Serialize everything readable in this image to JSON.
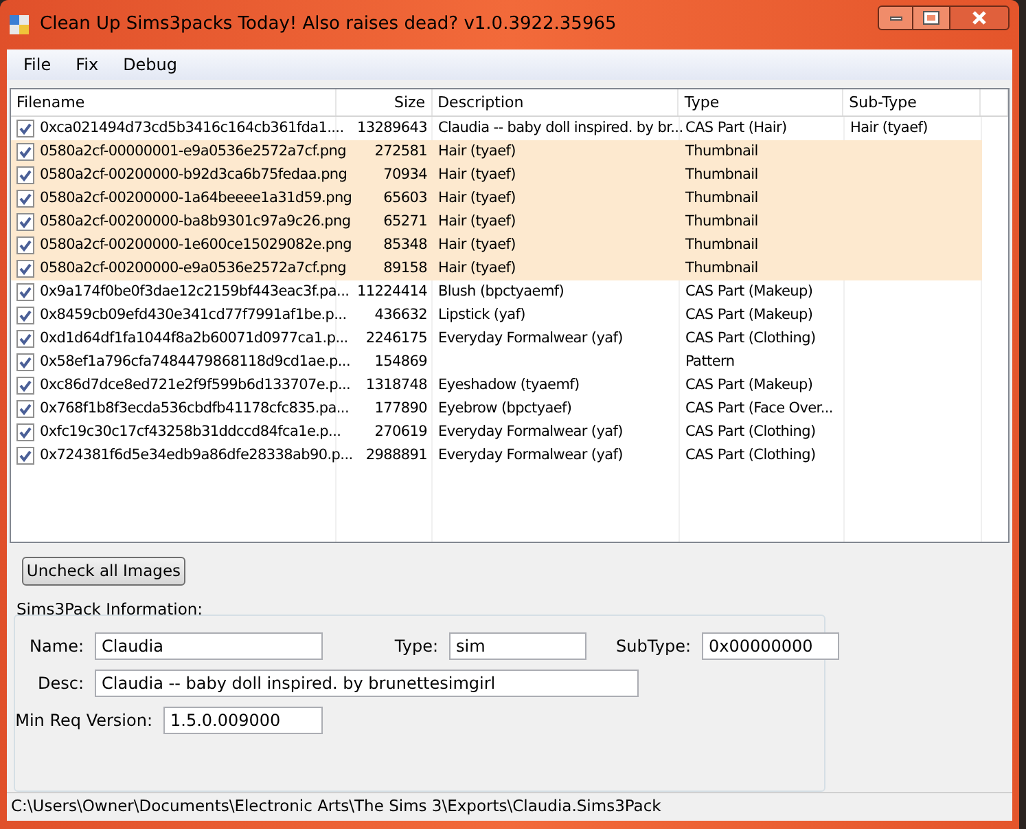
{
  "window": {
    "title": "Clean Up Sims3packs Today! Also raises dead? v1.0.3922.35965"
  },
  "menu": [
    "File",
    "Fix",
    "Debug"
  ],
  "table": {
    "columns": [
      "Filename",
      "Size",
      "Description",
      "Type",
      "Sub-Type"
    ],
    "rows": [
      {
        "checked": true,
        "highlighted": false,
        "cells": [
          "0xca021494d73cd5b3416c164cb361fda1....",
          "13289643",
          "Claudia -- baby doll inspired. by br...",
          "CAS Part (Hair)",
          "Hair (tyaef)"
        ]
      },
      {
        "checked": true,
        "highlighted": true,
        "cells": [
          "0580a2cf-00000001-e9a0536e2572a7cf.png",
          "272581",
          "Hair (tyaef)",
          "Thumbnail",
          ""
        ]
      },
      {
        "checked": true,
        "highlighted": true,
        "cells": [
          "0580a2cf-00200000-b92d3ca6b75fedaa.png",
          "70934",
          "Hair (tyaef)",
          "Thumbnail",
          ""
        ]
      },
      {
        "checked": true,
        "highlighted": true,
        "cells": [
          "0580a2cf-00200000-1a64beeee1a31d59.png",
          "65603",
          "Hair (tyaef)",
          "Thumbnail",
          ""
        ]
      },
      {
        "checked": true,
        "highlighted": true,
        "cells": [
          "0580a2cf-00200000-ba8b9301c97a9c26.png",
          "65271",
          "Hair (tyaef)",
          "Thumbnail",
          ""
        ]
      },
      {
        "checked": true,
        "highlighted": true,
        "cells": [
          "0580a2cf-00200000-1e600ce15029082e.png",
          "85348",
          "Hair (tyaef)",
          "Thumbnail",
          ""
        ]
      },
      {
        "checked": true,
        "highlighted": true,
        "cells": [
          "0580a2cf-00200000-e9a0536e2572a7cf.png",
          "89158",
          "Hair (tyaef)",
          "Thumbnail",
          ""
        ]
      },
      {
        "checked": true,
        "highlighted": false,
        "cells": [
          "0x9a174f0be0f3dae12c2159bf443eac3f.pa...",
          "11224414",
          "Blush (bpctyaemf)",
          "CAS Part (Makeup)",
          ""
        ]
      },
      {
        "checked": true,
        "highlighted": false,
        "cells": [
          "0x8459cb09efd430e341cd77f7991af1be.p...",
          "436632",
          "Lipstick (yaf)",
          "CAS Part (Makeup)",
          ""
        ]
      },
      {
        "checked": true,
        "highlighted": false,
        "cells": [
          "0xd1d64df1fa1044f8a2b60071d0977ca1.p...",
          "2246175",
          "Everyday Formalwear  (yaf)",
          "CAS Part (Clothing)",
          ""
        ]
      },
      {
        "checked": true,
        "highlighted": false,
        "cells": [
          "0x58ef1a796cfa7484479868118d9cd1ae.p...",
          "154869",
          "",
          "Pattern",
          ""
        ]
      },
      {
        "checked": true,
        "highlighted": false,
        "cells": [
          "0xc86d7dce8ed721e2f9f599b6d133707e.p...",
          "1318748",
          "Eyeshadow (tyaemf)",
          "CAS Part (Makeup)",
          ""
        ]
      },
      {
        "checked": true,
        "highlighted": false,
        "cells": [
          "0x768f1b8f3ecda536cbdfb41178cfc835.pa...",
          "177890",
          "Eyebrow (bpctyaef)",
          "CAS Part (Face Over...",
          ""
        ]
      },
      {
        "checked": true,
        "highlighted": false,
        "cells": [
          "0xfc19c30c17cf43258b31ddccd84fca1e.p...",
          "270619",
          "Everyday Formalwear  (yaf)",
          "CAS Part (Clothing)",
          ""
        ]
      },
      {
        "checked": true,
        "highlighted": false,
        "cells": [
          "0x724381f6d5e34edb9a86dfe28338ab90.p...",
          "2988891",
          "Everyday Formalwear  (yaf)",
          "CAS Part (Clothing)",
          ""
        ]
      }
    ]
  },
  "uncheck_button": "Uncheck all Images",
  "info": {
    "title": "Sims3Pack Information:",
    "name": {
      "label": "Name:",
      "value": "Claudia"
    },
    "type": {
      "label": "Type:",
      "value": "sim"
    },
    "subtype": {
      "label": "SubType:",
      "value": "0x00000000"
    },
    "desc": {
      "label": "Desc:",
      "value": "Claudia -- baby doll inspired. by brunettesimgirl"
    },
    "min_version": {
      "label": "Min Req Version:",
      "value": "1.5.0.009000"
    }
  },
  "status_bar": "C:\\Users\\Owner\\Documents\\Electronic Arts\\The Sims 3\\Exports\\Claudia.Sims3Pack"
}
